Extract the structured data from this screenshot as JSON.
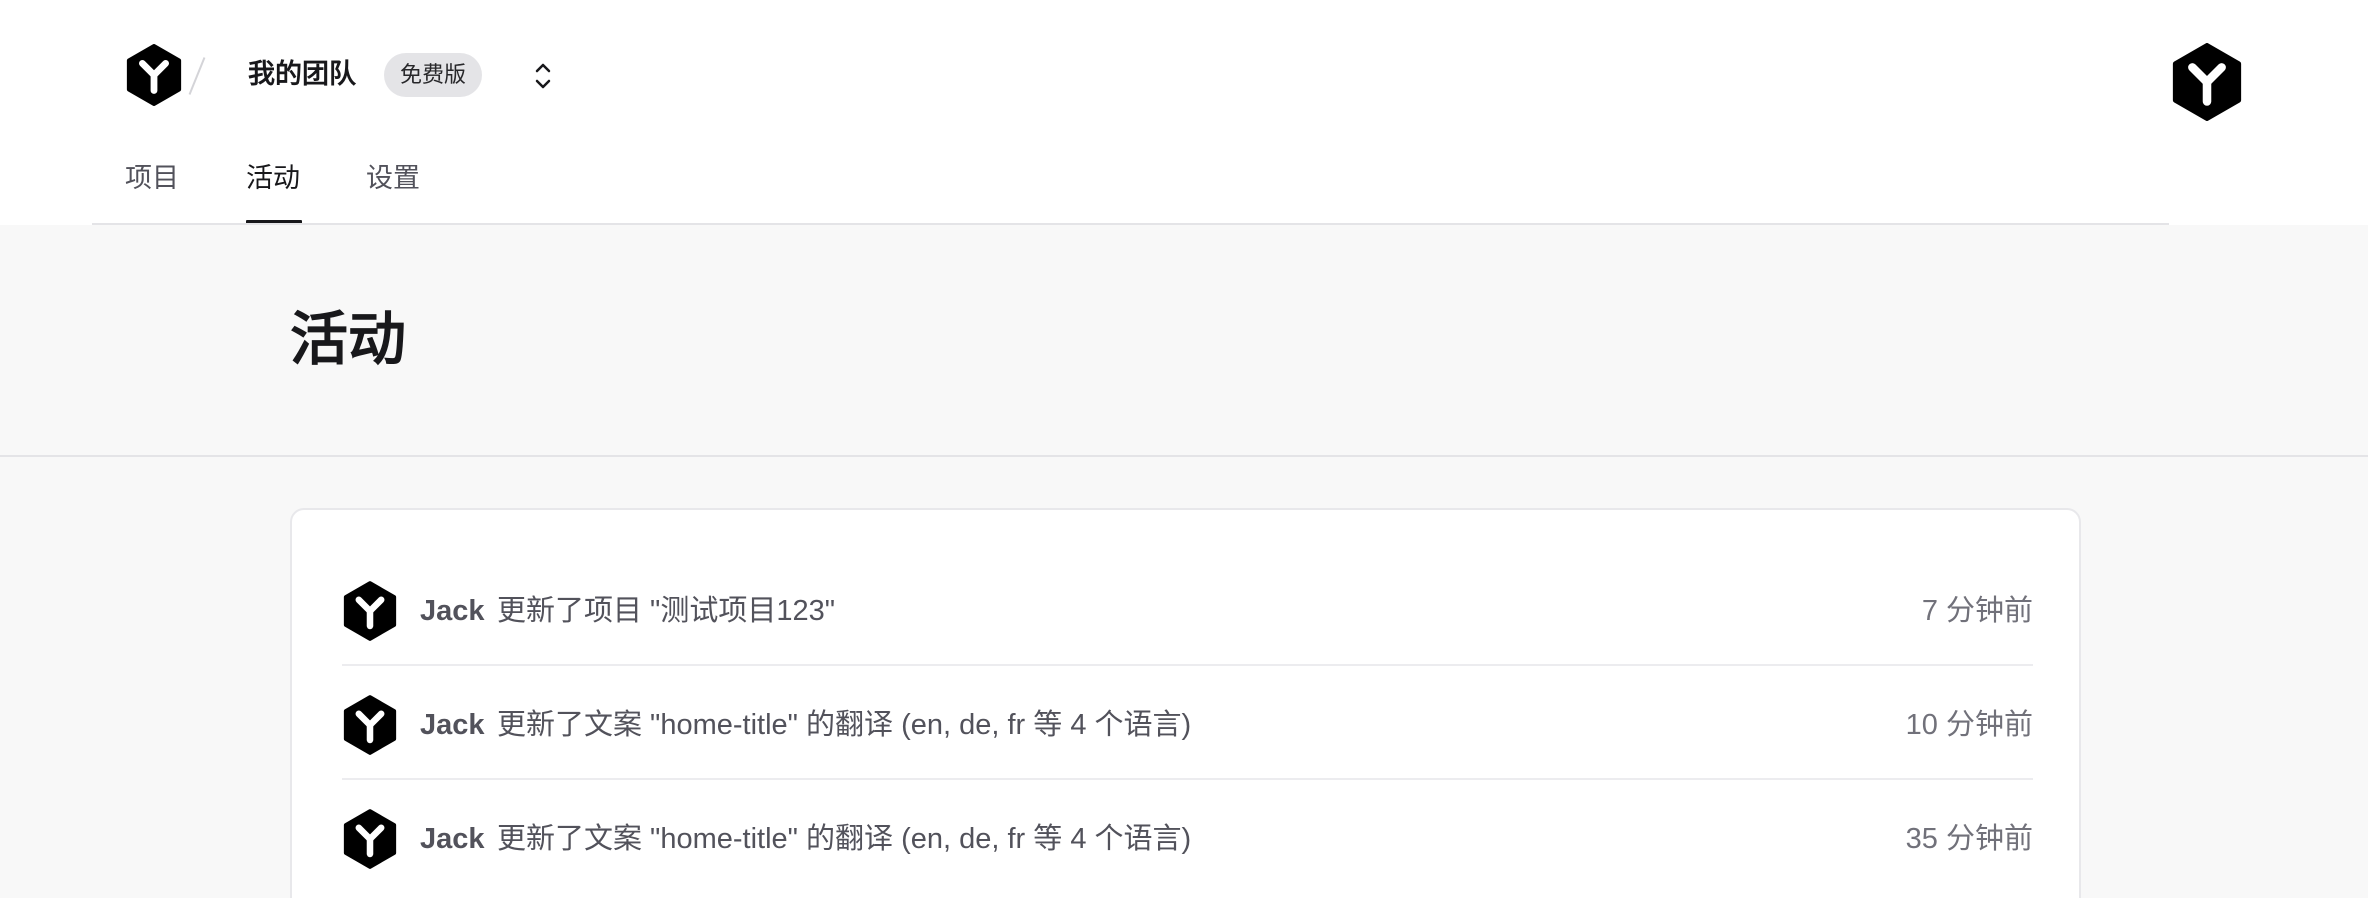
{
  "header": {
    "team_name": "我的团队",
    "plan_badge": "免费版"
  },
  "tabs": [
    {
      "label": "项目",
      "active": false
    },
    {
      "label": "活动",
      "active": true
    },
    {
      "label": "设置",
      "active": false
    }
  ],
  "page": {
    "title": "活动"
  },
  "activities": [
    {
      "actor": "Jack",
      "message": "更新了项目 \"测试项目123\"",
      "time": "7 分钟前"
    },
    {
      "actor": "Jack",
      "message": "更新了文案 \"home-title\" 的翻译 (en, de, fr 等 4 个语言)",
      "time": "10 分钟前"
    },
    {
      "actor": "Jack",
      "message": "更新了文案 \"home-title\" 的翻译 (en, de, fr 等 4 个语言)",
      "time": "35 分钟前"
    }
  ],
  "colors": {
    "brand": "#000000",
    "background": "#f8f8f8",
    "active_tab": "#18181b",
    "muted_text": "#71717a"
  },
  "icons": {
    "team_logo": "y-hexagon-logo-icon",
    "user_avatar": "y-hexagon-avatar-icon",
    "switcher": "chevron-up-down-icon"
  }
}
